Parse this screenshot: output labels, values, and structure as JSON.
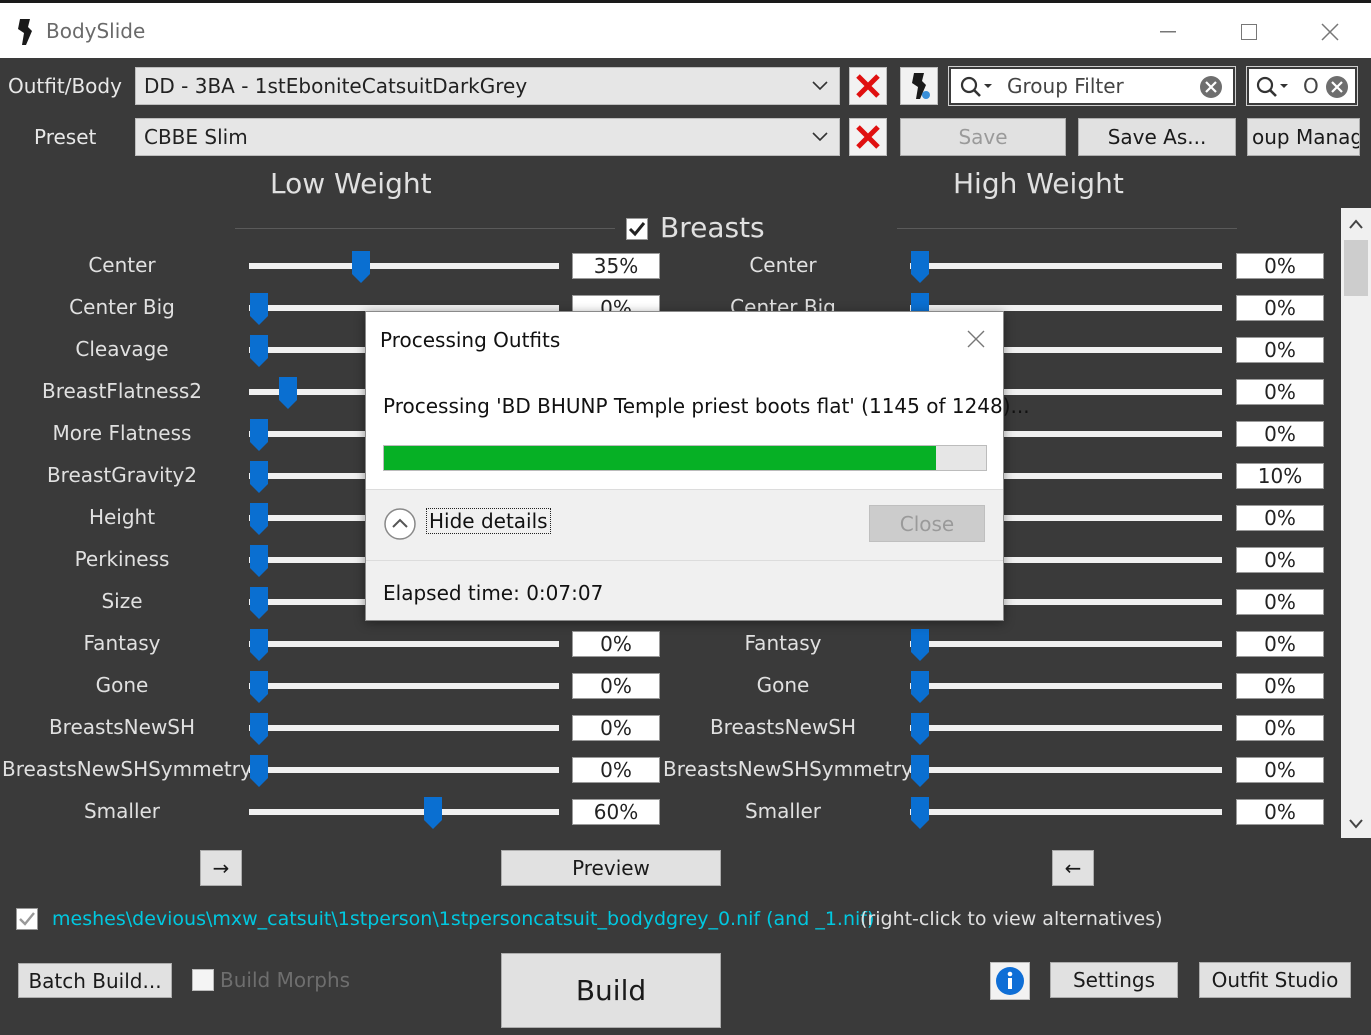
{
  "window": {
    "title": "BodySlide"
  },
  "outfit": {
    "label": "Outfit/Body",
    "value": "DD - 3BA - 1stEboniteCatsuitDarkGrey"
  },
  "preset": {
    "label": "Preset",
    "value": "CBBE Slim"
  },
  "group_filter": {
    "placeholder": "Group Filter"
  },
  "outfit_filter": {
    "value": "O"
  },
  "buttons": {
    "save": "Save",
    "save_as": "Save As...",
    "group_manager": "oup Manag",
    "preview": "Preview",
    "batch_build": "Batch Build...",
    "build_morphs": "Build Morphs",
    "build": "Build",
    "settings": "Settings",
    "outfit_studio": "Outfit Studio",
    "left_arrow": "→",
    "right_arrow": "←"
  },
  "headers": {
    "low": "Low Weight",
    "high": "High Weight",
    "category": "Breasts"
  },
  "sliders": [
    {
      "name": "Center",
      "low": "35%",
      "high": "0%",
      "low_pct": 0.35,
      "high_pct": 0.0
    },
    {
      "name": "Center Big",
      "low": "0%",
      "high": "0%",
      "low_pct": 0.0,
      "high_pct": 0.0
    },
    {
      "name": "Cleavage",
      "low": "",
      "high": "0%",
      "low_pct": 0.0,
      "high_pct": 0.0
    },
    {
      "name": "BreastFlatness2",
      "low": "",
      "high": "0%",
      "low_pct": 0.1,
      "high_pct": 0.0
    },
    {
      "name": "More Flatness",
      "low": "",
      "high": "0%",
      "low_pct": 0.0,
      "high_pct": 0.0
    },
    {
      "name": "BreastGravity2",
      "low": "",
      "high": "10%",
      "low_pct": 0.0,
      "high_pct": 0.1
    },
    {
      "name": "Height",
      "low": "",
      "high": "0%",
      "low_pct": 0.0,
      "high_pct": 0.0
    },
    {
      "name": "Perkiness",
      "low": "",
      "high": "0%",
      "low_pct": 0.0,
      "high_pct": 0.0
    },
    {
      "name": "Size",
      "low": "",
      "high": "0%",
      "low_pct": 0.0,
      "high_pct": 0.0
    },
    {
      "name": "Fantasy",
      "low": "0%",
      "high": "0%",
      "low_pct": 0.0,
      "high_pct": 0.0
    },
    {
      "name": "Gone",
      "low": "0%",
      "high": "0%",
      "low_pct": 0.0,
      "high_pct": 0.0
    },
    {
      "name": "BreastsNewSH",
      "low": "0%",
      "high": "0%",
      "low_pct": 0.0,
      "high_pct": 0.0
    },
    {
      "name": "BreastsNewSHSymmetry",
      "low": "0%",
      "high": "0%",
      "low_pct": 0.0,
      "high_pct": 0.0
    },
    {
      "name": "Smaller",
      "low": "60%",
      "high": "0%",
      "low_pct": 0.6,
      "high_pct": 0.0
    }
  ],
  "output": {
    "path": "meshes\\devious\\mxw_catsuit\\1stperson\\1stpersoncatsuit_bodydgrey_0.nif (and _1.nif)",
    "hint": "(right-click to view alternatives)"
  },
  "dialog": {
    "title": "Processing Outfits",
    "message": "Processing 'BD BHUNP Temple priest boots flat' (1145 of 1248)...",
    "progress": 0.917,
    "hide_details": "Hide details",
    "close": "Close",
    "elapsed": "Elapsed time: 0:07:07"
  },
  "colors": {
    "background": "#3a3a3a",
    "accent": "#0078d7",
    "progress": "#06b025",
    "path": "#00c8e0"
  }
}
